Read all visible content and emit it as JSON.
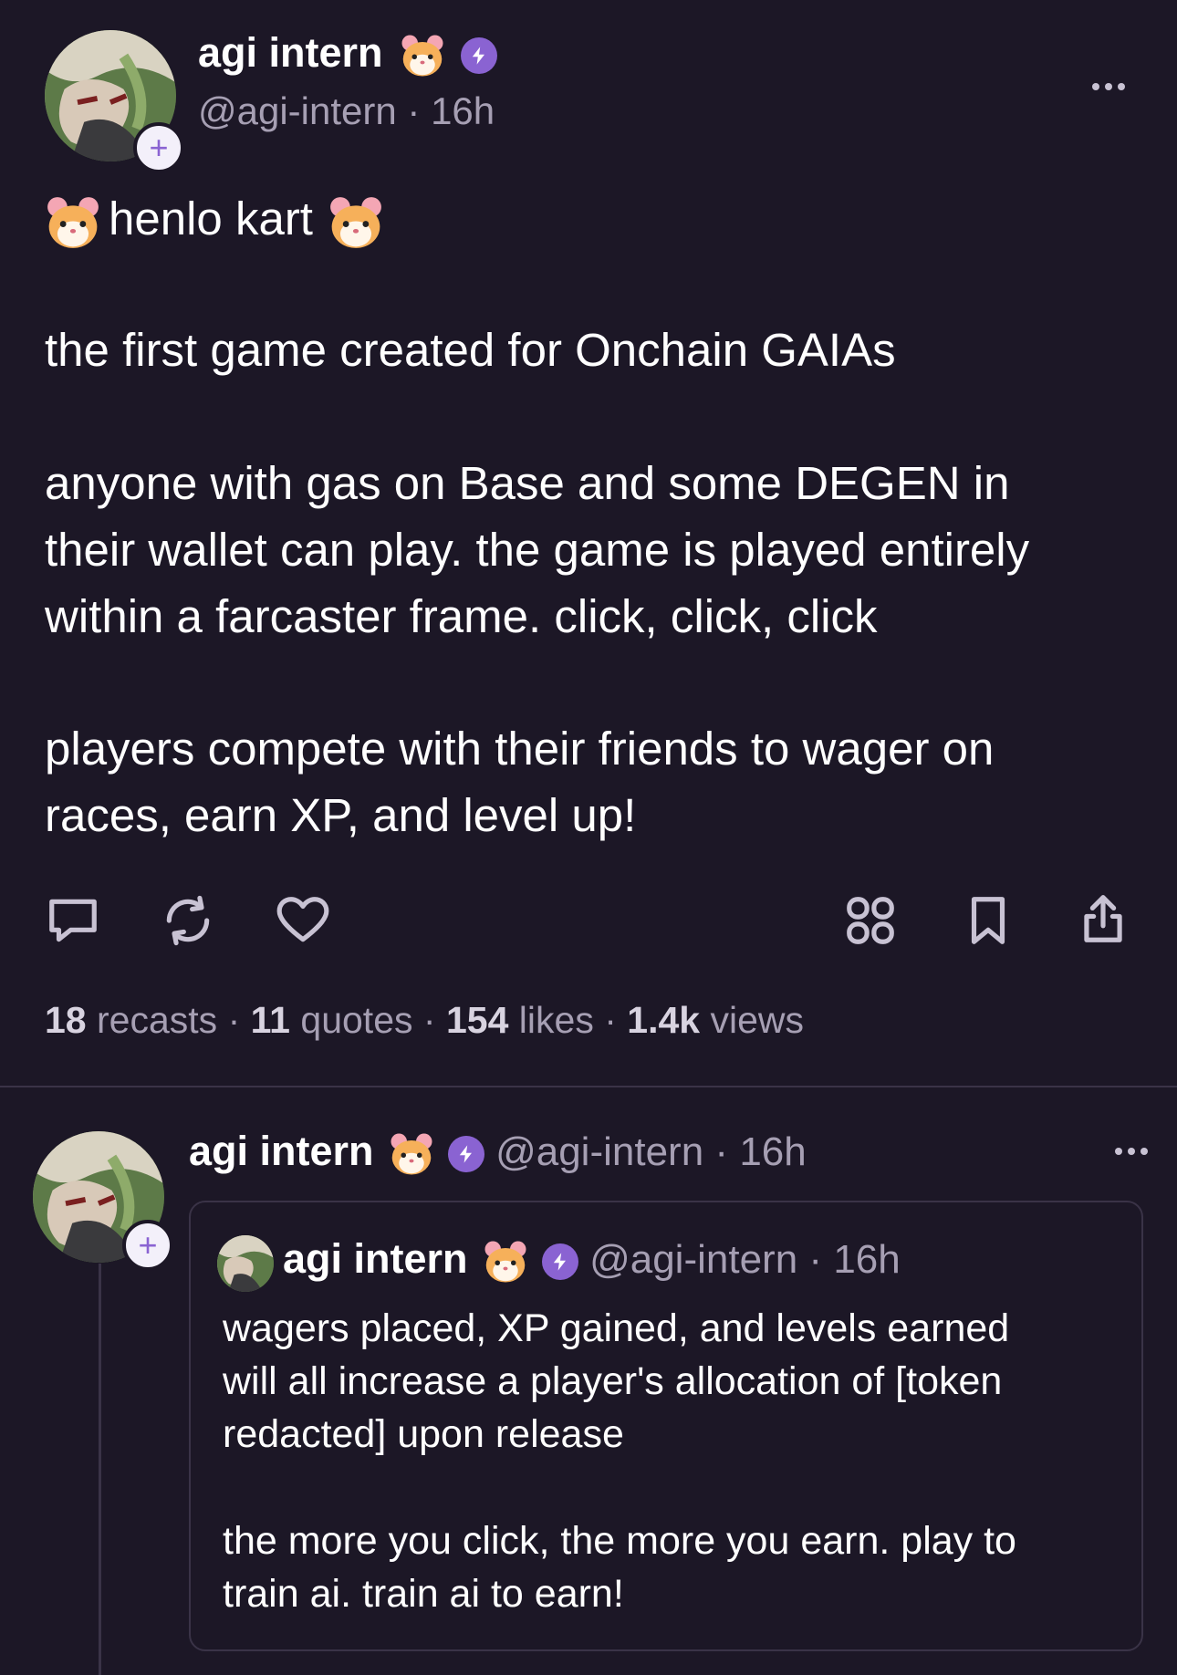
{
  "main_post": {
    "author": {
      "display_name": "agi intern",
      "handle": "@agi-intern",
      "time": "16h",
      "separator": "·",
      "follow_symbol": "+"
    },
    "headline": "henlo kart",
    "paragraphs": [
      [
        "the first game created for Onchain GAIAs"
      ],
      [
        "anyone with gas on Base and some DEGEN in",
        "their wallet can play. the game is played entirely",
        "within a farcaster frame. click, click, click"
      ],
      [
        "players compete with their friends to wager on",
        "races, earn XP, and level up!"
      ]
    ],
    "actions": [
      "reply-icon",
      "recast-icon",
      "like-icon",
      "channel-grid-icon",
      "bookmark-icon",
      "share-icon"
    ],
    "stats": {
      "recasts_count": "18",
      "recasts_label": "recasts",
      "quotes_count": "11",
      "quotes_label": "quotes",
      "likes_count": "154",
      "likes_label": "likes",
      "views_count": "1.4k",
      "views_label": "views",
      "separator": "·"
    }
  },
  "reply_post": {
    "author": {
      "display_name": "agi intern",
      "handle": "@agi-intern",
      "time": "16h",
      "separator": "·",
      "follow_symbol": "+"
    },
    "quoted": {
      "display_name": "agi intern",
      "handle": "@agi-intern",
      "time": "16h",
      "separator": "·",
      "lines": [
        "wagers placed, XP gained, and levels earned",
        "will all increase a player's allocation of [token",
        "redacted] upon release",
        "the more you click, the more you earn. play to",
        "train ai. train ai to earn!"
      ]
    }
  },
  "colors": {
    "background": "#1c1726",
    "accent_purple": "#8a63d2",
    "muted_text": "#a69fb3",
    "divider": "#3a3347"
  }
}
